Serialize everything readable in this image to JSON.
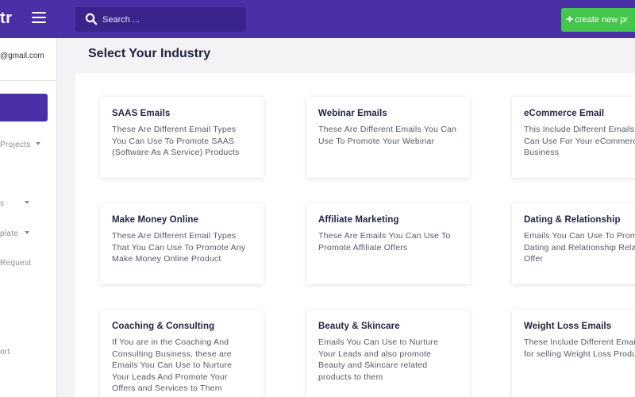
{
  "topbar": {
    "logo": "tr",
    "search_placeholder": "Search ...",
    "create_label": "create new pr"
  },
  "sidebar": {
    "email": "@gmail.com",
    "items": [
      {
        "label": "Projects",
        "caret": true
      },
      {
        "label": "s",
        "caret": true
      },
      {
        "label": "plate",
        "caret": true
      },
      {
        "label": "Request",
        "caret": false
      },
      {
        "label": "ort",
        "caret": false
      }
    ]
  },
  "main": {
    "title": "Select Your Industry",
    "cards": [
      {
        "title": "SAAS Emails",
        "desc": "These Are Different Email Types You Can Use To Promote SAAS (Software As A Service) Products"
      },
      {
        "title": "Webinar Emails",
        "desc": "These Are Different Emails You Can Use To Promote Your Webinar"
      },
      {
        "title": "eCommerce Email",
        "desc": "This Include Different Emails You Can Use For Your eCommerce Business"
      },
      {
        "title": "Make Money Online",
        "desc": "These Are Different Email Types That You Can Use To Promote Any Make Money Online Product"
      },
      {
        "title": "Affiliate Marketing",
        "desc": "These Are Emails You Can Use To Promote Affiliate Offers"
      },
      {
        "title": "Dating & Relationship",
        "desc": "Emails You Can Use To Promote Dating and Relationship Related Offer"
      },
      {
        "title": "Coaching & Consulting",
        "desc": "If You are in the Coaching And Consulting Business, these are Emails You Can Use to Nurture Your Leads And Promote Your Offers and Services to Them"
      },
      {
        "title": "Beauty & Skincare",
        "desc": "Emails You Can Use to Nurture Your Leads and also promote Beauty and Skincare related products to them"
      },
      {
        "title": "Weight Loss Emails",
        "desc": "These Include Different Email Types for selling Weight Loss Products"
      }
    ]
  },
  "colors": {
    "topbar": "#4a2fa6",
    "search_bg": "#3a238a",
    "create_button": "#43c64a",
    "title_text": "#1f2340"
  },
  "icons": {
    "menu": "hamburger-icon",
    "search": "search-icon",
    "create": "plus-icon",
    "caret": "caret-down-icon"
  }
}
